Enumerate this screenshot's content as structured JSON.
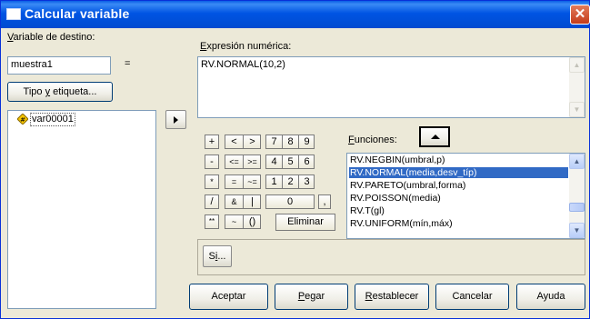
{
  "window": {
    "title": "Calcular variable"
  },
  "target": {
    "label": "Variable de destino:",
    "value": "muestra1",
    "equals": "="
  },
  "type_label_button": "Tipo y etiqueta...",
  "variables": [
    {
      "name": "var00001"
    }
  ],
  "expression": {
    "label": "Expresión numérica:",
    "value": "RV.NORMAL(10,2)"
  },
  "keypad": {
    "row1": [
      "+",
      "<",
      ">",
      "7",
      "8",
      "9"
    ],
    "row2": [
      "-",
      "<=",
      ">=",
      "4",
      "5",
      "6"
    ],
    "row3": [
      "*",
      "=",
      "~=",
      "1",
      "2",
      "3"
    ],
    "row4": [
      "/",
      "&",
      "|",
      "0",
      ","
    ],
    "row5": [
      "**",
      "~",
      "()"
    ],
    "delete": "Eliminar"
  },
  "functions": {
    "label": "Funciones:",
    "items": [
      "RV.NEGBIN(umbral,p)",
      "RV.NORMAL(media,desv_típ)",
      "RV.PARETO(umbral,forma)",
      "RV.POISSON(media)",
      "RV.T(gl)",
      "RV.UNIFORM(mín,máx)"
    ],
    "selected_index": 1
  },
  "if_button": "Si...",
  "footer": {
    "ok": "Aceptar",
    "paste": "Pegar",
    "reset": "Restablecer",
    "cancel": "Cancelar",
    "help": "Ayuda"
  },
  "colors": {
    "selection": "#316ac5",
    "titlebar": "#0054e3",
    "dialog": "#ece9d8"
  }
}
